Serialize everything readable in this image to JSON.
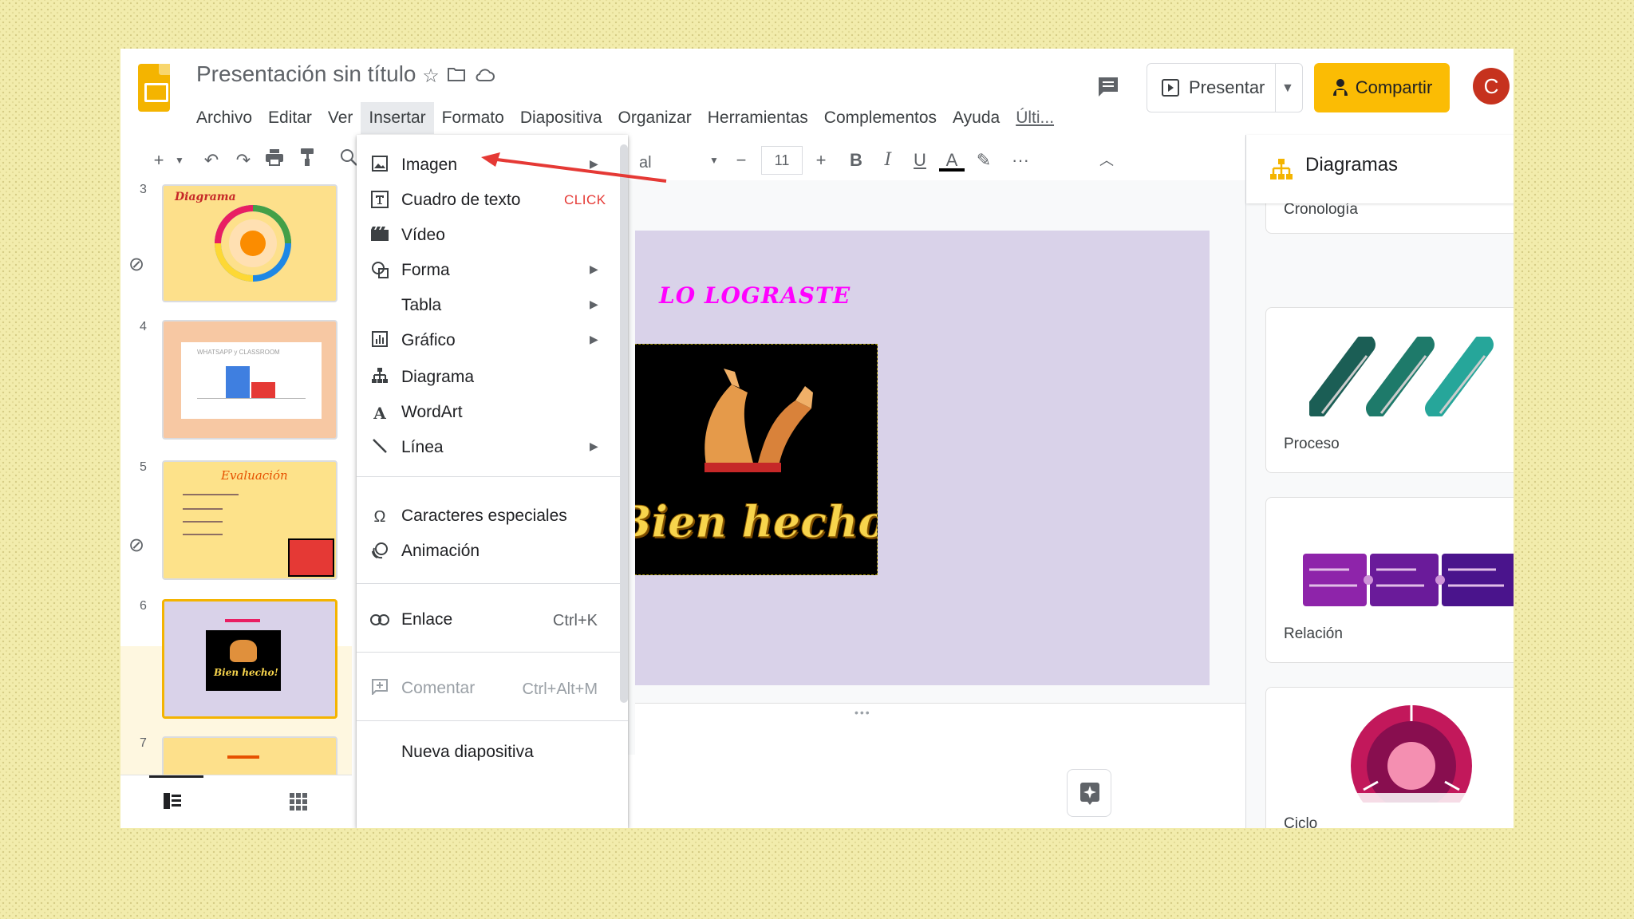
{
  "header": {
    "doc_title": "Presentación sin título",
    "menus": [
      "Archivo",
      "Editar",
      "Ver",
      "Insertar",
      "Formato",
      "Diapositiva",
      "Organizar",
      "Herramientas",
      "Complementos",
      "Ayuda",
      "Últi..."
    ],
    "active_menu": "Insertar",
    "present_label": "Presentar",
    "share_label": "Compartir",
    "avatar_letter": "C"
  },
  "toolbar": {
    "font_name": "al",
    "font_size": "11",
    "bold": "B",
    "italic": "I",
    "underline": "U",
    "text_color": "A",
    "more": "···"
  },
  "filmstrip": {
    "slides": [
      {
        "num": "3",
        "title": "Diagrama"
      },
      {
        "num": "4",
        "title": "WHATSAPP y CLASSROOM"
      },
      {
        "num": "5",
        "title": "Evaluación"
      },
      {
        "num": "6",
        "title": "Bien hecho!"
      },
      {
        "num": "7",
        "title": ""
      }
    ],
    "selected": "6"
  },
  "insert_menu": {
    "items": [
      {
        "label": "Imagen",
        "icon": "image-icon",
        "submenu": true
      },
      {
        "label": "Cuadro de texto",
        "icon": "textbox-icon"
      },
      {
        "label": "Vídeo",
        "icon": "video-icon"
      },
      {
        "label": "Forma",
        "icon": "shape-icon",
        "submenu": true
      },
      {
        "label": "Tabla",
        "icon": "",
        "submenu": true
      },
      {
        "label": "Gráfico",
        "icon": "chart-icon",
        "submenu": true
      },
      {
        "label": "Diagrama",
        "icon": "diagram-icon"
      },
      {
        "label": "WordArt",
        "icon": "wordart-icon"
      },
      {
        "label": "Línea",
        "icon": "line-icon",
        "submenu": true
      },
      {
        "label": "Caracteres especiales",
        "icon": "omega-icon"
      },
      {
        "label": "Animación",
        "icon": "animation-icon"
      },
      {
        "label": "Enlace",
        "icon": "link-icon",
        "shortcut": "Ctrl+K"
      },
      {
        "label": "Comentar",
        "icon": "comment-add-icon",
        "shortcut": "Ctrl+Alt+M",
        "disabled": true
      },
      {
        "label": "Nueva diapositiva",
        "icon": ""
      }
    ],
    "annotation": "CLICK"
  },
  "slide": {
    "heading": "LO LOGRASTE",
    "image_text": "Bien hecho!"
  },
  "diagrams_panel": {
    "title": "Diagramas",
    "cards": [
      {
        "label": "Cronología"
      },
      {
        "label": "Proceso"
      },
      {
        "label": "Relación"
      },
      {
        "label": "Ciclo"
      }
    ]
  },
  "colors": {
    "accent": "#fbbc04",
    "slides_logo": "#f4b400",
    "annotation_red": "#e53935",
    "slide_bg": "#d9d2e9",
    "avatar": "#c6321e"
  }
}
